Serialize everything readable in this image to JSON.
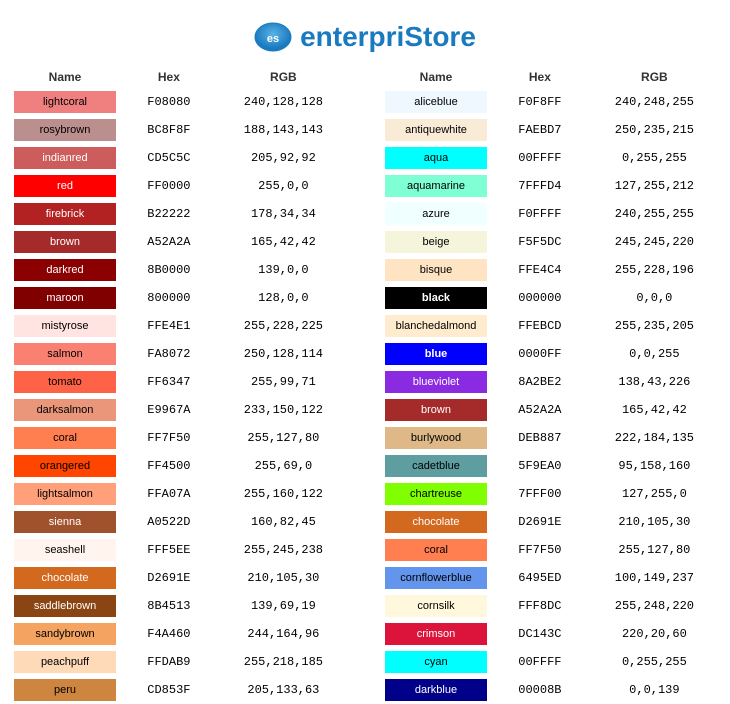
{
  "header": {
    "title_normal": "enterpri",
    "title_bold": "Store",
    "logo_letter": "es"
  },
  "left_table": {
    "headers": [
      "Name",
      "Hex",
      "RGB"
    ],
    "rows": [
      {
        "name": "lightcoral",
        "hex": "F08080",
        "rgb": "240,128,128",
        "bg": "#F08080",
        "text": "#000"
      },
      {
        "name": "rosybrown",
        "hex": "BC8F8F",
        "rgb": "188,143,143",
        "bg": "#BC8F8F",
        "text": "#000"
      },
      {
        "name": "indianred",
        "hex": "CD5C5C",
        "rgb": "205,92,92",
        "bg": "#CD5C5C",
        "text": "#fff"
      },
      {
        "name": "red",
        "hex": "FF0000",
        "rgb": "255,0,0",
        "bg": "#FF0000",
        "text": "#fff"
      },
      {
        "name": "firebrick",
        "hex": "B22222",
        "rgb": "178,34,34",
        "bg": "#B22222",
        "text": "#fff"
      },
      {
        "name": "brown",
        "hex": "A52A2A",
        "rgb": "165,42,42",
        "bg": "#A52A2A",
        "text": "#fff"
      },
      {
        "name": "darkred",
        "hex": "8B0000",
        "rgb": "139,0,0",
        "bg": "#8B0000",
        "text": "#fff"
      },
      {
        "name": "maroon",
        "hex": "800000",
        "rgb": "128,0,0",
        "bg": "#800000",
        "text": "#fff"
      },
      {
        "name": "mistyrose",
        "hex": "FFE4E1",
        "rgb": "255,228,225",
        "bg": "#FFE4E1",
        "text": "#000"
      },
      {
        "name": "salmon",
        "hex": "FA8072",
        "rgb": "250,128,114",
        "bg": "#FA8072",
        "text": "#000"
      },
      {
        "name": "tomato",
        "hex": "FF6347",
        "rgb": "255,99,71",
        "bg": "#FF6347",
        "text": "#000"
      },
      {
        "name": "darksalmon",
        "hex": "E9967A",
        "rgb": "233,150,122",
        "bg": "#E9967A",
        "text": "#000"
      },
      {
        "name": "coral",
        "hex": "FF7F50",
        "rgb": "255,127,80",
        "bg": "#FF7F50",
        "text": "#000"
      },
      {
        "name": "orangered",
        "hex": "FF4500",
        "rgb": "255,69,0",
        "bg": "#FF4500",
        "text": "#000"
      },
      {
        "name": "lightsalmon",
        "hex": "FFA07A",
        "rgb": "255,160,122",
        "bg": "#FFA07A",
        "text": "#000"
      },
      {
        "name": "sienna",
        "hex": "A0522D",
        "rgb": "160,82,45",
        "bg": "#A0522D",
        "text": "#fff"
      },
      {
        "name": "seashell",
        "hex": "FFF5EE",
        "rgb": "255,245,238",
        "bg": "#FFF5EE",
        "text": "#000"
      },
      {
        "name": "chocolate",
        "hex": "D2691E",
        "rgb": "210,105,30",
        "bg": "#D2691E",
        "text": "#fff"
      },
      {
        "name": "saddlebrown",
        "hex": "8B4513",
        "rgb": "139,69,19",
        "bg": "#8B4513",
        "text": "#fff"
      },
      {
        "name": "sandybrown",
        "hex": "F4A460",
        "rgb": "244,164,96",
        "bg": "#F4A460",
        "text": "#000"
      },
      {
        "name": "peachpuff",
        "hex": "FFDAB9",
        "rgb": "255,218,185",
        "bg": "#FFDAB9",
        "text": "#000"
      },
      {
        "name": "peru",
        "hex": "CD853F",
        "rgb": "205,133,63",
        "bg": "#CD853F",
        "text": "#000"
      }
    ]
  },
  "right_table": {
    "headers": [
      "Name",
      "Hex",
      "RGB"
    ],
    "rows": [
      {
        "name": "aliceblue",
        "hex": "F0F8FF",
        "rgb": "240,248,255",
        "bg": "#F0F8FF",
        "text": "#000"
      },
      {
        "name": "antiquewhite",
        "hex": "FAEBD7",
        "rgb": "250,235,215",
        "bg": "#FAEBD7",
        "text": "#000"
      },
      {
        "name": "aqua",
        "hex": "00FFFF",
        "rgb": "0,255,255",
        "bg": "#00FFFF",
        "text": "#000"
      },
      {
        "name": "aquamarine",
        "hex": "7FFFD4",
        "rgb": "127,255,212",
        "bg": "#7FFFD4",
        "text": "#000"
      },
      {
        "name": "azure",
        "hex": "F0FFFF",
        "rgb": "240,255,255",
        "bg": "#F0FFFF",
        "text": "#000"
      },
      {
        "name": "beige",
        "hex": "F5F5DC",
        "rgb": "245,245,220",
        "bg": "#F5F5DC",
        "text": "#000"
      },
      {
        "name": "bisque",
        "hex": "FFE4C4",
        "rgb": "255,228,196",
        "bg": "#FFE4C4",
        "text": "#000"
      },
      {
        "name": "black",
        "hex": "000000",
        "rgb": "0,0,0",
        "bg": "#000000",
        "text": "#fff"
      },
      {
        "name": "blanchedalmond",
        "hex": "FFEBCD",
        "rgb": "255,235,205",
        "bg": "#FFEBCD",
        "text": "#000"
      },
      {
        "name": "blue",
        "hex": "0000FF",
        "rgb": "0,0,255",
        "bg": "#0000FF",
        "text": "#fff"
      },
      {
        "name": "blueviolet",
        "hex": "8A2BE2",
        "rgb": "138,43,226",
        "bg": "#8A2BE2",
        "text": "#fff"
      },
      {
        "name": "brown",
        "hex": "A52A2A",
        "rgb": "165,42,42",
        "bg": "#A52A2A",
        "text": "#fff"
      },
      {
        "name": "burlywood",
        "hex": "DEB887",
        "rgb": "222,184,135",
        "bg": "#DEB887",
        "text": "#000"
      },
      {
        "name": "cadetblue",
        "hex": "5F9EA0",
        "rgb": "95,158,160",
        "bg": "#5F9EA0",
        "text": "#000"
      },
      {
        "name": "chartreuse",
        "hex": "7FFF00",
        "rgb": "127,255,0",
        "bg": "#7FFF00",
        "text": "#000"
      },
      {
        "name": "chocolate",
        "hex": "D2691E",
        "rgb": "210,105,30",
        "bg": "#D2691E",
        "text": "#fff"
      },
      {
        "name": "coral",
        "hex": "FF7F50",
        "rgb": "255,127,80",
        "bg": "#FF7F50",
        "text": "#000"
      },
      {
        "name": "cornflowerblue",
        "hex": "6495ED",
        "rgb": "100,149,237",
        "bg": "#6495ED",
        "text": "#000"
      },
      {
        "name": "cornsilk",
        "hex": "FFF8DC",
        "rgb": "255,248,220",
        "bg": "#FFF8DC",
        "text": "#000"
      },
      {
        "name": "crimson",
        "hex": "DC143C",
        "rgb": "220,20,60",
        "bg": "#DC143C",
        "text": "#fff"
      },
      {
        "name": "cyan",
        "hex": "00FFFF",
        "rgb": "0,255,255",
        "bg": "#00FFFF",
        "text": "#000"
      },
      {
        "name": "darkblue",
        "hex": "00008B",
        "rgb": "0,0,139",
        "bg": "#00008B",
        "text": "#fff"
      }
    ]
  }
}
